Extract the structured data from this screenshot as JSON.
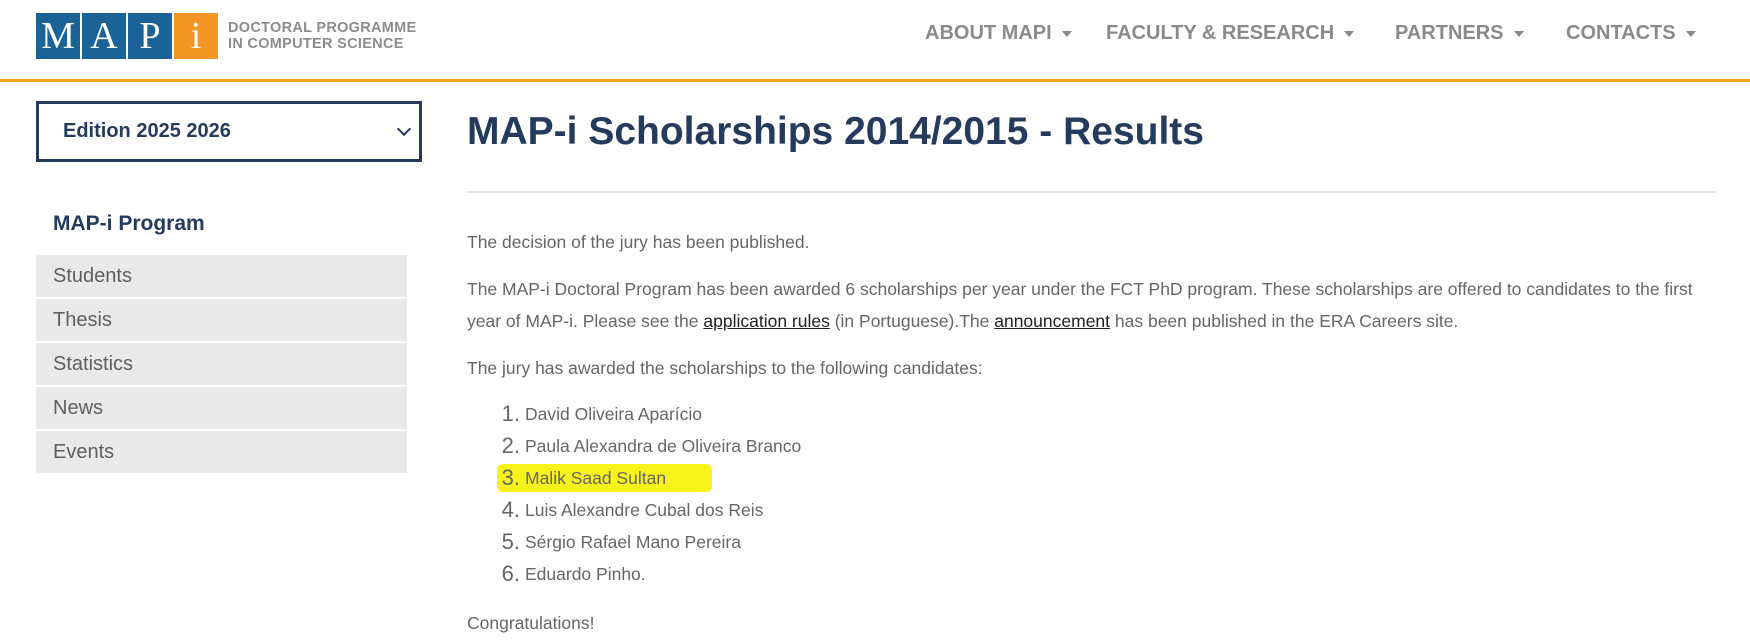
{
  "header": {
    "logo": {
      "letters": [
        "M",
        "A",
        "P",
        "i"
      ],
      "line1": "DOCTORAL PROGRAMME",
      "line2": "IN COMPUTER SCIENCE"
    },
    "nav": [
      {
        "label": "ABOUT MAPI"
      },
      {
        "label": "FACULTY & RESEARCH"
      },
      {
        "label": "PARTNERS"
      },
      {
        "label": "CONTACTS"
      }
    ]
  },
  "sidebar": {
    "edition_select": "Edition 2025 2026",
    "section_title": "MAP-i Program",
    "items": [
      {
        "label": "Students"
      },
      {
        "label": "Thesis"
      },
      {
        "label": "Statistics"
      },
      {
        "label": "News"
      },
      {
        "label": "Events"
      }
    ]
  },
  "main": {
    "title": "MAP-i Scholarships 2014/2015 - Results",
    "para1": "The decision of the jury has been published.",
    "para2": {
      "before_link1": "The MAP-i Doctoral Program has been awarded 6 scholarships per year under the FCT PhD program. These scholarships are offered to candidates to the first year of MAP-i. Please see the ",
      "link1": "application rules",
      "between": " (in Portuguese).The ",
      "link2": "announcement",
      "after_link2": " has been published in the ERA Careers site."
    },
    "para3": "The jury has awarded the scholarships to the following candidates:",
    "candidates": [
      {
        "num": "1.",
        "name": "David Oliveira Aparício"
      },
      {
        "num": "2.",
        "name": "Paula Alexandra de Oliveira Branco"
      },
      {
        "num": "3.",
        "name": "Malik Saad Sultan",
        "highlighted": true
      },
      {
        "num": "4.",
        "name": "Luis Alexandre Cubal dos Reis"
      },
      {
        "num": "5.",
        "name": "Sérgio Rafael Mano Pereira"
      },
      {
        "num": "6.",
        "name": "Eduardo Pinho."
      }
    ],
    "closing": "Congratulations!"
  },
  "colors": {
    "accent_orange": "#f5a01a",
    "brand_blue": "#1b6396",
    "navy": "#243b5e",
    "highlight": "#f7f31a"
  }
}
